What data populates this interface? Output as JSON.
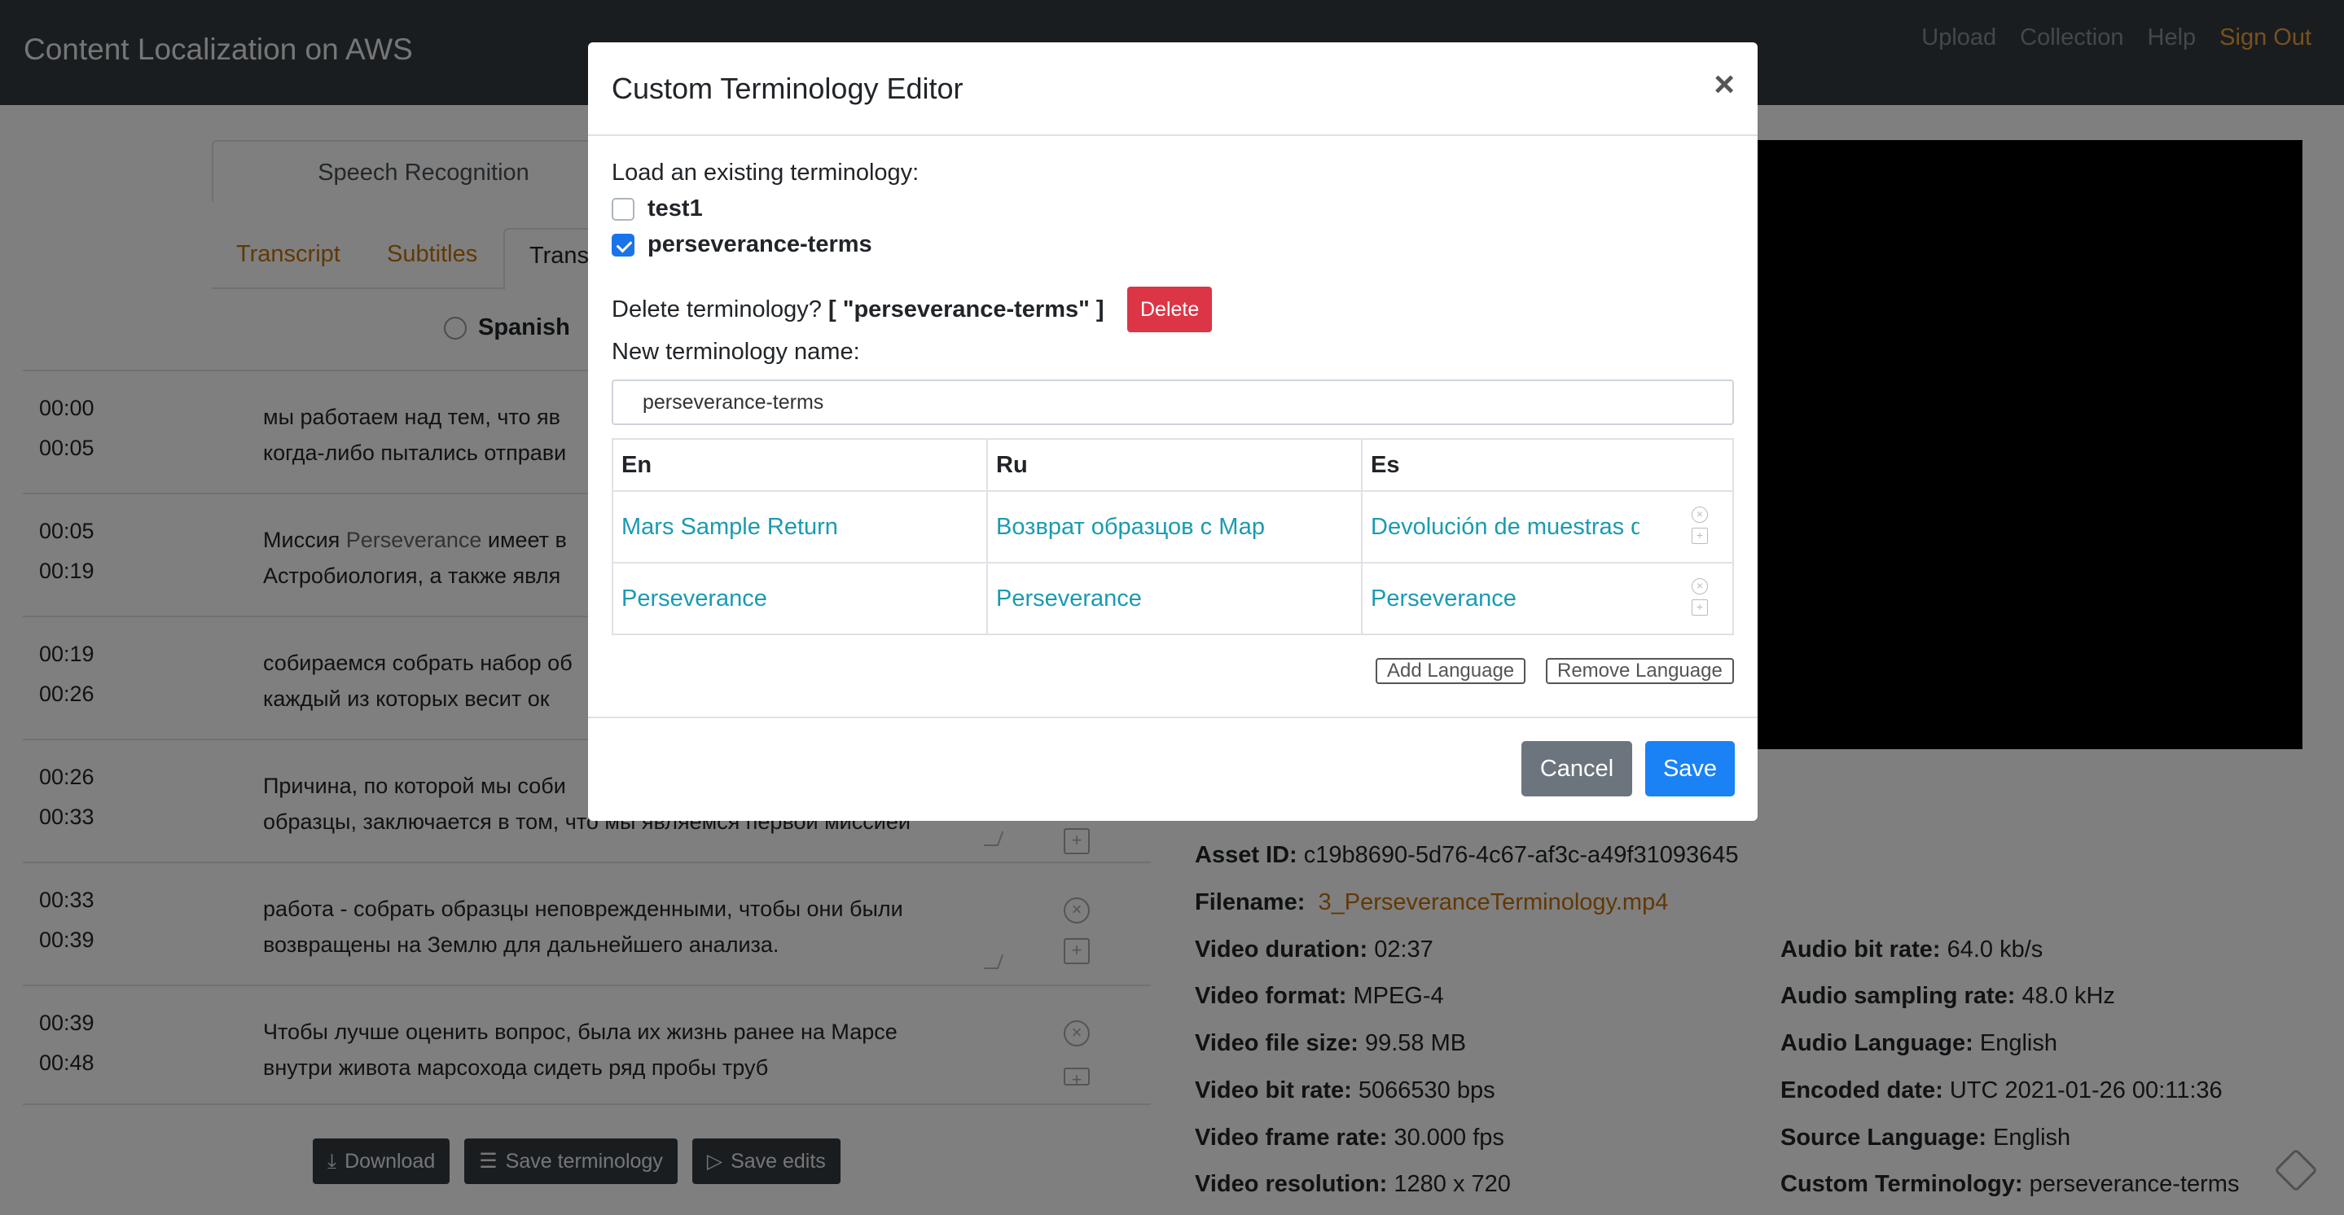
{
  "navbar": {
    "brand": "Content Localization on AWS",
    "links": [
      "Upload",
      "Collection",
      "Help"
    ],
    "signout": "Sign Out"
  },
  "background": {
    "card_tab": "Speech Recognition",
    "sub_tabs": [
      "Transcript",
      "Subtitles",
      "Transl"
    ],
    "language_radio": "Spanish",
    "rows": [
      {
        "start": "00:00",
        "end": "00:05",
        "line1": "мы работаем над тем, что яв",
        "line2": "когда-либо пытались отправи"
      },
      {
        "start": "00:05",
        "end": "00:19",
        "line1_a": "Миссия ",
        "line1_b": "Perseverance",
        "line1_c": " имеет в",
        "line2": "Астробиология, а также явля"
      },
      {
        "start": "00:19",
        "end": "00:26",
        "line1": "собираемся собрать набор об",
        "line2": "каждый из которых весит ок"
      },
      {
        "start": "00:26",
        "end": "00:33",
        "line1": "Причина, по которой мы соби",
        "line2": "образцы, заключается в том, что мы являемся первой миссией"
      },
      {
        "start": "00:33",
        "end": "00:39",
        "line1": "работа - собрать образцы неповрежденными, чтобы они были",
        "line2": "возвращены на Землю для дальнейшего анализа."
      },
      {
        "start": "00:39",
        "end": "00:48",
        "line1": "Чтобы лучше оценить вопрос, была их жизнь ранее на Марсе",
        "line2": "внутри живота марсохода сидеть ряд пробы труб"
      }
    ],
    "buttons": {
      "download": "Download",
      "save_terminology": "Save terminology",
      "save_edits": "Save edits"
    },
    "asset": {
      "asset_id_label": "Asset ID:",
      "asset_id": "c19b8690-5d76-4c67-af3c-a49f31093645",
      "filename_label": "Filename:",
      "filename": "3_PerseveranceTerminology.mp4",
      "duration_label": "Video duration:",
      "duration": "02:37",
      "format_label": "Video format:",
      "format": "MPEG-4",
      "filesize_label": "Video file size:",
      "filesize": "99.58 MB",
      "bitrate_label": "Video bit rate:",
      "bitrate": "5066530 bps",
      "framerate_label": "Video frame rate:",
      "framerate": "30.000 fps",
      "resolution_label": "Video resolution:",
      "resolution": "1280 x 720",
      "audio_bitrate_label": "Audio bit rate:",
      "audio_bitrate": "64.0 kb/s",
      "audio_sampling_label": "Audio sampling rate:",
      "audio_sampling": "48.0 kHz",
      "audio_lang_label": "Audio Language:",
      "audio_lang": "English",
      "encoded_label": "Encoded date:",
      "encoded": "UTC 2021-01-26 00:11:36",
      "source_lang_label": "Source Language:",
      "source_lang": "English",
      "custom_term_label": "Custom Terminology:",
      "custom_term": "perseverance-terms"
    }
  },
  "modal": {
    "title": "Custom Terminology Editor",
    "close": "×",
    "load_label": "Load an existing terminology:",
    "options": [
      "test1",
      "perseverance-terms"
    ],
    "delete_prompt": "Delete terminology?",
    "delete_target": "[ \"perseverance-terms\" ]",
    "delete_button": "Delete",
    "new_name_label": "New terminology name:",
    "new_name_value": "perseverance-terms",
    "table": {
      "headers": [
        "En",
        "Ru",
        "Es"
      ],
      "rows": [
        [
          "Mars Sample Return",
          "Возврат образцов с Марса",
          "Devolución de muestras de Marte"
        ],
        [
          "Perseverance",
          "Perseverance",
          "Perseverance"
        ]
      ]
    },
    "add_language": "Add Language",
    "remove_language": "Remove Language",
    "cancel": "Cancel",
    "save": "Save"
  }
}
